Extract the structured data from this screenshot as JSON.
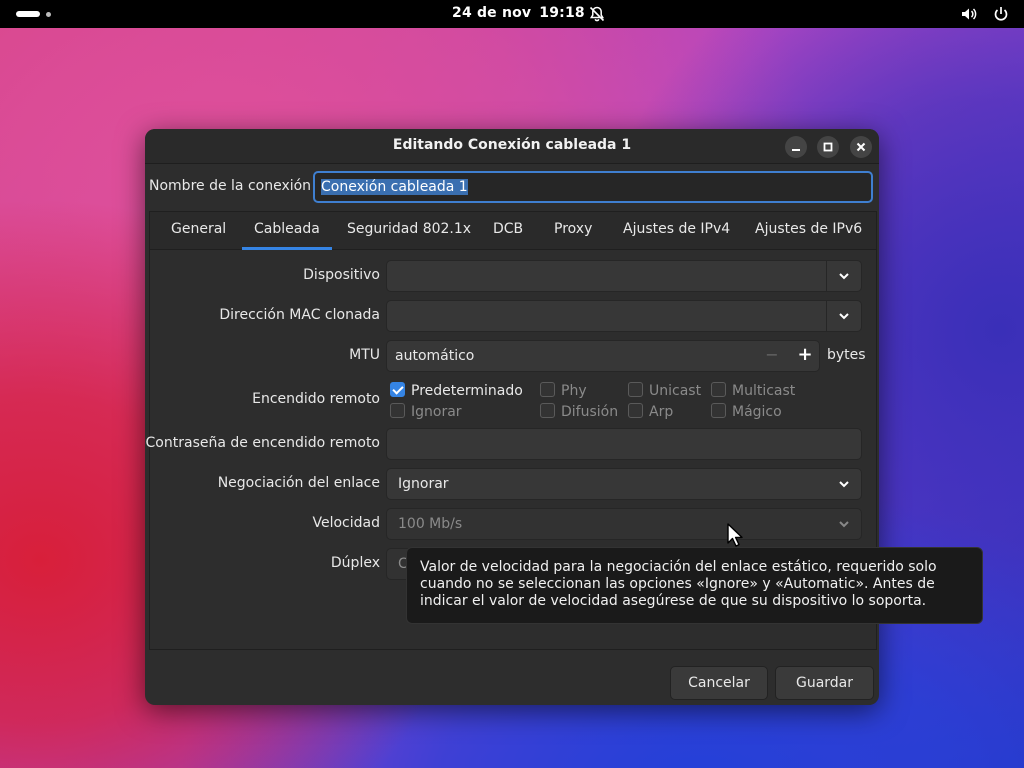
{
  "topbar": {
    "date": "24 de nov",
    "time": "19:18",
    "icons": [
      "activities-indicator",
      "notifications-off-icon",
      "volume-icon",
      "power-icon"
    ]
  },
  "dialog": {
    "title": "Editando Conexión cableada 1",
    "connection_name_label": "Nombre de la conexión",
    "connection_name_value": "Conexión cableada 1",
    "tabs": [
      "General",
      "Cableada",
      "Seguridad 802.1x",
      "DCB",
      "Proxy",
      "Ajustes de IPv4",
      "Ajustes de IPv6"
    ],
    "active_tab": "Cableada",
    "fields": {
      "device_label": "Dispositivo",
      "device_value": "",
      "cloned_mac_label": "Dirección MAC clonada",
      "cloned_mac_value": "",
      "mtu_label": "MTU",
      "mtu_value": "automático",
      "mtu_minus": "−",
      "mtu_plus": "+",
      "mtu_unit": "bytes",
      "wake_on_lan_label": "Encendido remoto",
      "wake_on_lan_options": [
        {
          "label": "Predeterminado",
          "checked": true
        },
        {
          "label": "Phy",
          "checked": false
        },
        {
          "label": "Unicast",
          "checked": false
        },
        {
          "label": "Multicast",
          "checked": false
        },
        {
          "label": "Ignorar",
          "checked": false
        },
        {
          "label": "Difusión",
          "checked": false
        },
        {
          "label": "Arp",
          "checked": false
        },
        {
          "label": "Mágico",
          "checked": false
        }
      ],
      "wol_password_label": "Contraseña de encendido remoto",
      "wol_password_value": "",
      "link_negotiation_label": "Negociación del enlace",
      "link_negotiation_value": "Ignorar",
      "speed_label": "Velocidad",
      "speed_value": "100 Mb/s",
      "duplex_label": "Dúplex",
      "duplex_value_partial": "Co"
    },
    "buttons": {
      "cancel": "Cancelar",
      "save": "Guardar"
    },
    "tooltip": "Valor de velocidad para la negociación del enlace estático, requerido solo cuando no se seleccionan las opciones «Ignore» y «Automatic». Antes de indicar el valor de velocidad asegúrese de que su dispositivo lo soporta."
  },
  "colors": {
    "accent": "#3584e4",
    "dialog_bg": "#2d2d2d",
    "topbar_bg": "#000000",
    "tooltip_bg": "#1a1a1a"
  }
}
